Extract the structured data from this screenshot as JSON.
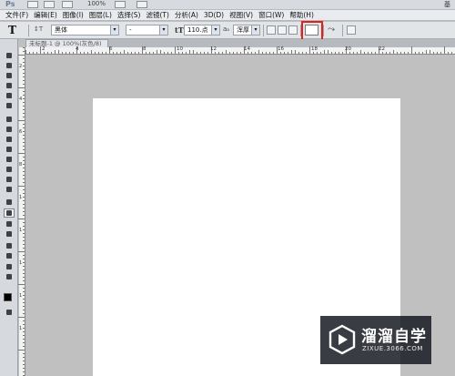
{
  "app": {
    "logo": "Ps",
    "zoom": "100%",
    "cut_text": "基"
  },
  "menu": [
    "文件(F)",
    "编辑(E)",
    "图像(I)",
    "图层(L)",
    "选择(S)",
    "滤镜(T)",
    "分析(A)",
    "3D(D)",
    "视图(V)",
    "窗口(W)",
    "帮助(H)"
  ],
  "options": {
    "tool_glyph": "T",
    "orient_glyph": "↕T",
    "font_family": "黑体",
    "font_style": "-",
    "font_size": "110.点",
    "aa_glyph": "aₐ",
    "antialias": "浑厚",
    "text_color": "#ffffff",
    "highlight_color": "#e0201c"
  },
  "document_tab": {
    "title": "未标题-1 @ 100%(灰色/8)"
  },
  "ruler_top_labels": [
    "2",
    "4",
    "6",
    "8",
    "10",
    "12",
    "14",
    "16",
    "18",
    "20",
    "22"
  ],
  "ruler_left_labels": [
    "2",
    "4",
    "6",
    "8",
    "1",
    "1",
    "1",
    "1",
    "1"
  ],
  "watermark": {
    "name": "溜溜自学",
    "url": "ZIXUE.3066.COM"
  },
  "colors": {
    "canvas_bg": "#c0c0c0",
    "document": "#ffffff"
  }
}
